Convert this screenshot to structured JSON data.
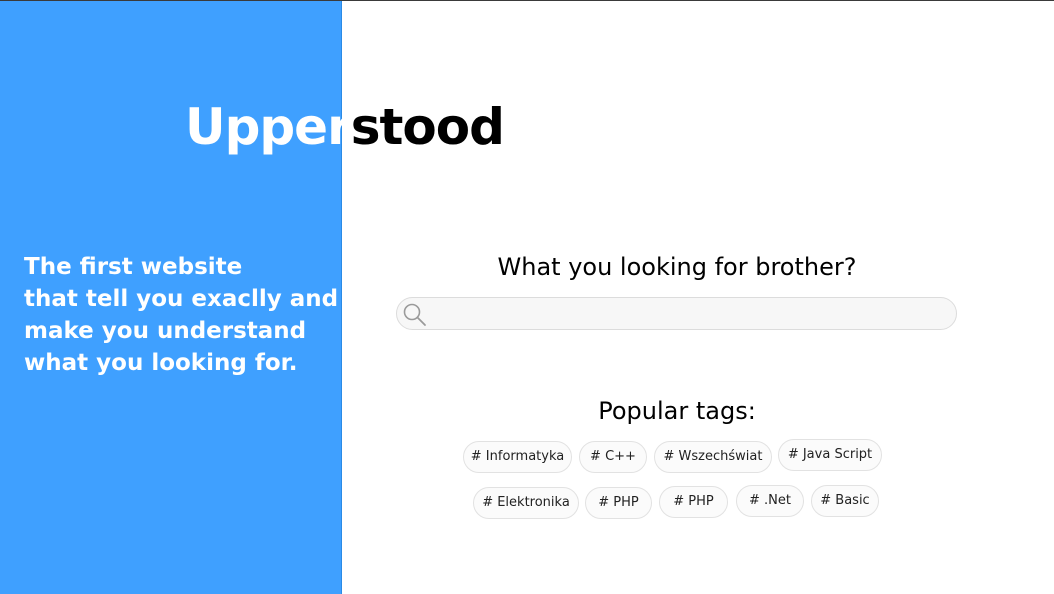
{
  "brand": {
    "logo_left": "Upper",
    "logo_right": "stood"
  },
  "hero": {
    "tagline_lines": [
      "The first website",
      "that tell you exaclly and",
      "make you understand",
      "what you looking for."
    ]
  },
  "search": {
    "heading": "What you looking for brother?",
    "value": "",
    "placeholder": "",
    "icon": "search-icon"
  },
  "tags": {
    "heading": "Popular tags:",
    "items": [
      "# Informatyka",
      "# C++",
      "# Wszechświat",
      "# Java Script",
      "# Elektronika",
      "# PHP",
      "# PHP",
      "# .Net",
      "# Basic"
    ]
  },
  "colors": {
    "accent": "#3fa0ff",
    "background": "#ffffff",
    "text": "#000000"
  }
}
